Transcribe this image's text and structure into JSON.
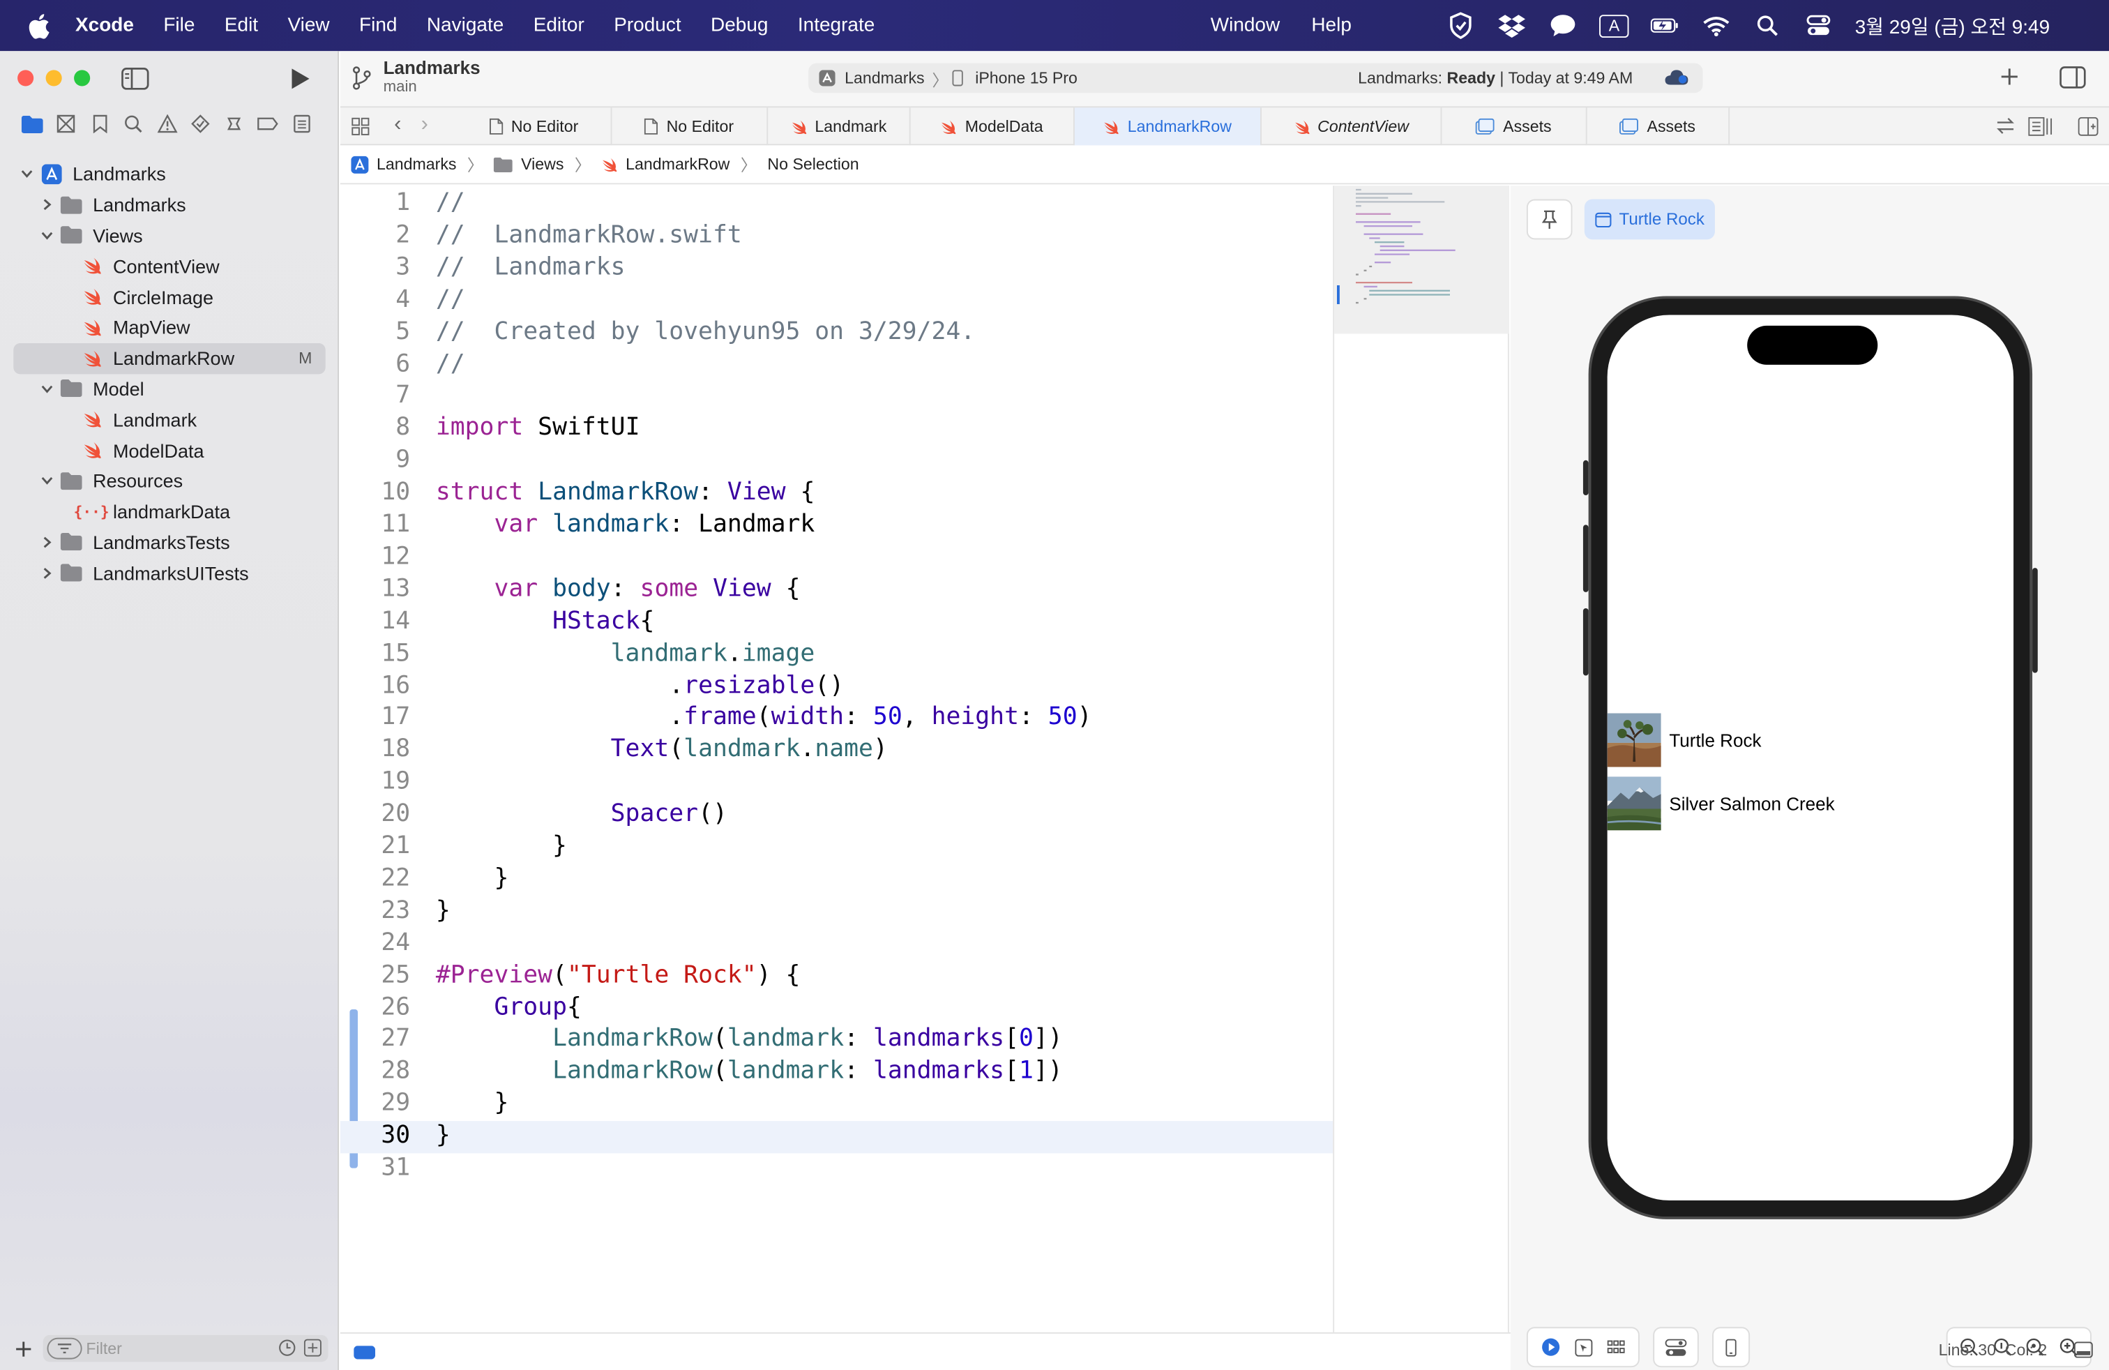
{
  "menubar": {
    "app_name": "Xcode",
    "items": [
      "File",
      "Edit",
      "View",
      "Find",
      "Navigate",
      "Editor",
      "Product",
      "Debug",
      "Integrate"
    ],
    "right_items": [
      "Window",
      "Help"
    ],
    "input_source": "A",
    "clock": "3월 29일 (금) 오전 9:49"
  },
  "toolbar": {
    "project_title": "Landmarks",
    "branch": "main",
    "scheme": "Landmarks",
    "destination": "iPhone 15 Pro",
    "status_prefix": "Landmarks: ",
    "status_state": "Ready",
    "status_suffix": " | Today at 9:49 AM"
  },
  "navigator": {
    "tree": [
      {
        "label": "Landmarks",
        "kind": "project",
        "expanded": true
      },
      {
        "label": "Landmarks",
        "kind": "folder",
        "expanded": false
      },
      {
        "label": "Views",
        "kind": "folder",
        "expanded": true
      },
      {
        "label": "ContentView",
        "kind": "swift"
      },
      {
        "label": "CircleImage",
        "kind": "swift"
      },
      {
        "label": "MapView",
        "kind": "swift"
      },
      {
        "label": "LandmarkRow",
        "kind": "swift",
        "selected": true,
        "badge": "M"
      },
      {
        "label": "Model",
        "kind": "folder",
        "expanded": true
      },
      {
        "label": "Landmark",
        "kind": "swift"
      },
      {
        "label": "ModelData",
        "kind": "swift"
      },
      {
        "label": "Resources",
        "kind": "folder",
        "expanded": true
      },
      {
        "label": "landmarkData",
        "kind": "json"
      },
      {
        "label": "LandmarksTests",
        "kind": "folder",
        "expanded": false
      },
      {
        "label": "LandmarksUITests",
        "kind": "folder",
        "expanded": false
      }
    ],
    "filter_placeholder": "Filter"
  },
  "tabs": [
    {
      "label": "No Editor",
      "icon": "doc-icon"
    },
    {
      "label": "No Editor",
      "icon": "doc-icon"
    },
    {
      "label": "Landmark",
      "icon": "swift-icon"
    },
    {
      "label": "ModelData",
      "icon": "swift-icon"
    },
    {
      "label": "LandmarkRow",
      "icon": "swift-icon",
      "active": true
    },
    {
      "label": "ContentView",
      "icon": "swift-icon",
      "italic": true
    },
    {
      "label": "Assets",
      "icon": "assets-icon"
    },
    {
      "label": "Assets",
      "icon": "assets-icon"
    }
  ],
  "jumpbar": {
    "items": [
      "Landmarks",
      "Views",
      "LandmarkRow",
      "No Selection"
    ]
  },
  "editor": {
    "current_line": 30,
    "lines": [
      [
        [
          "//",
          "cm"
        ]
      ],
      [
        [
          "//  LandmarkRow.swift",
          "cm"
        ]
      ],
      [
        [
          "//  Landmarks",
          "cm"
        ]
      ],
      [
        [
          "//",
          "cm"
        ]
      ],
      [
        [
          "//  Created by lovehyun95 on 3/29/24.",
          "cm"
        ]
      ],
      [
        [
          "//",
          "cm"
        ]
      ],
      [],
      [
        [
          "import",
          "kw"
        ],
        [
          " SwiftUI",
          "pl"
        ]
      ],
      [],
      [
        [
          "struct",
          "kw"
        ],
        [
          " ",
          "pl"
        ],
        [
          "LandmarkRow",
          "ty"
        ],
        [
          ": ",
          "pl"
        ],
        [
          "View",
          "ty2"
        ],
        [
          " {",
          "pl"
        ]
      ],
      [
        [
          "    ",
          "pl"
        ],
        [
          "var",
          "kw"
        ],
        [
          " ",
          "pl"
        ],
        [
          "landmark",
          "ty"
        ],
        [
          ": Landmark",
          "pl"
        ]
      ],
      [],
      [
        [
          "    ",
          "pl"
        ],
        [
          "var",
          "kw"
        ],
        [
          " ",
          "pl"
        ],
        [
          "body",
          "ty"
        ],
        [
          ": ",
          "pl"
        ],
        [
          "some",
          "kw"
        ],
        [
          " ",
          "pl"
        ],
        [
          "View",
          "ty2"
        ],
        [
          " {",
          "pl"
        ]
      ],
      [
        [
          "        ",
          "pl"
        ],
        [
          "HStack",
          "fn"
        ],
        [
          "{",
          "pl"
        ]
      ],
      [
        [
          "            ",
          "pl"
        ],
        [
          "landmark",
          "id"
        ],
        [
          ".",
          "pl"
        ],
        [
          "image",
          "id"
        ]
      ],
      [
        [
          "                .",
          "pl"
        ],
        [
          "resizable",
          "fn"
        ],
        [
          "()",
          "pl"
        ]
      ],
      [
        [
          "                .",
          "pl"
        ],
        [
          "frame",
          "fn"
        ],
        [
          "(",
          "pl"
        ],
        [
          "width",
          "fn"
        ],
        [
          ": ",
          "pl"
        ],
        [
          "50",
          "nm"
        ],
        [
          ", ",
          "pl"
        ],
        [
          "height",
          "fn"
        ],
        [
          ": ",
          "pl"
        ],
        [
          "50",
          "nm"
        ],
        [
          ")",
          "pl"
        ]
      ],
      [
        [
          "            ",
          "pl"
        ],
        [
          "Text",
          "fn"
        ],
        [
          "(",
          "pl"
        ],
        [
          "landmark",
          "id"
        ],
        [
          ".",
          "pl"
        ],
        [
          "name",
          "id"
        ],
        [
          ")",
          "pl"
        ]
      ],
      [],
      [
        [
          "            ",
          "pl"
        ],
        [
          "Spacer",
          "fn"
        ],
        [
          "()",
          "pl"
        ]
      ],
      [
        [
          "        }",
          "pl"
        ]
      ],
      [
        [
          "    }",
          "pl"
        ]
      ],
      [
        [
          "}",
          "pl"
        ]
      ],
      [],
      [
        [
          "#Preview",
          "kw"
        ],
        [
          "(",
          "pl"
        ],
        [
          "\"Turtle Rock\"",
          "st"
        ],
        [
          ") {",
          "pl"
        ]
      ],
      [
        [
          "    ",
          "pl"
        ],
        [
          "Group",
          "fn"
        ],
        [
          "{",
          "pl"
        ]
      ],
      [
        [
          "        ",
          "pl"
        ],
        [
          "LandmarkRow",
          "id"
        ],
        [
          "(",
          "pl"
        ],
        [
          "landmark",
          "id"
        ],
        [
          ": ",
          "pl"
        ],
        [
          "landmarks",
          "fn"
        ],
        [
          "[",
          "pl"
        ],
        [
          "0",
          "nm"
        ],
        [
          "])",
          "pl"
        ]
      ],
      [
        [
          "        ",
          "pl"
        ],
        [
          "LandmarkRow",
          "id"
        ],
        [
          "(",
          "pl"
        ],
        [
          "landmark",
          "id"
        ],
        [
          ": ",
          "pl"
        ],
        [
          "landmarks",
          "fn"
        ],
        [
          "[",
          "pl"
        ],
        [
          "1",
          "nm"
        ],
        [
          "])",
          "pl"
        ]
      ],
      [
        [
          "    }",
          "pl"
        ]
      ],
      [
        [
          "}",
          "pl"
        ]
      ],
      []
    ]
  },
  "canvas": {
    "preview_tab": "Turtle Rock",
    "rows": [
      {
        "name": "Turtle Rock"
      },
      {
        "name": "Silver Salmon Creek"
      }
    ]
  },
  "statusbar": {
    "line": "Line: 30",
    "col": "Col: 2"
  },
  "colors": {
    "accent": "#2a6fdb",
    "swift_orange": "#f05138",
    "menubar": "#2a2872"
  }
}
